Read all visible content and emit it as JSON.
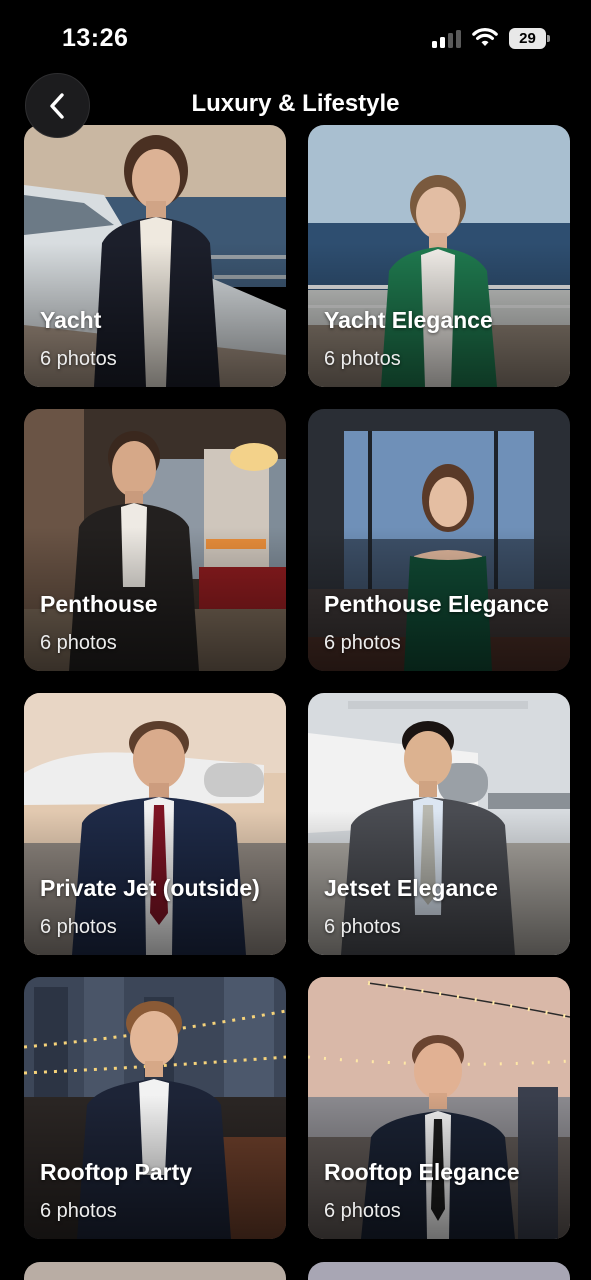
{
  "status_bar": {
    "time": "13:26",
    "battery": "29"
  },
  "header": {
    "title": "Luxury & Lifestyle",
    "back_icon": "chevron-left-icon"
  },
  "cards": [
    {
      "title": "Yacht",
      "count": "6 photos"
    },
    {
      "title": "Yacht Elegance",
      "count": "6 photos"
    },
    {
      "title": "Penthouse",
      "count": "6 photos"
    },
    {
      "title": "Penthouse Elegance",
      "count": "6 photos"
    },
    {
      "title": "Private Jet (outside)",
      "count": "6 photos"
    },
    {
      "title": "Jetset Elegance",
      "count": "6 photos"
    },
    {
      "title": "Rooftop Party",
      "count": "6 photos"
    },
    {
      "title": "Rooftop Elegance",
      "count": "6 photos"
    }
  ]
}
